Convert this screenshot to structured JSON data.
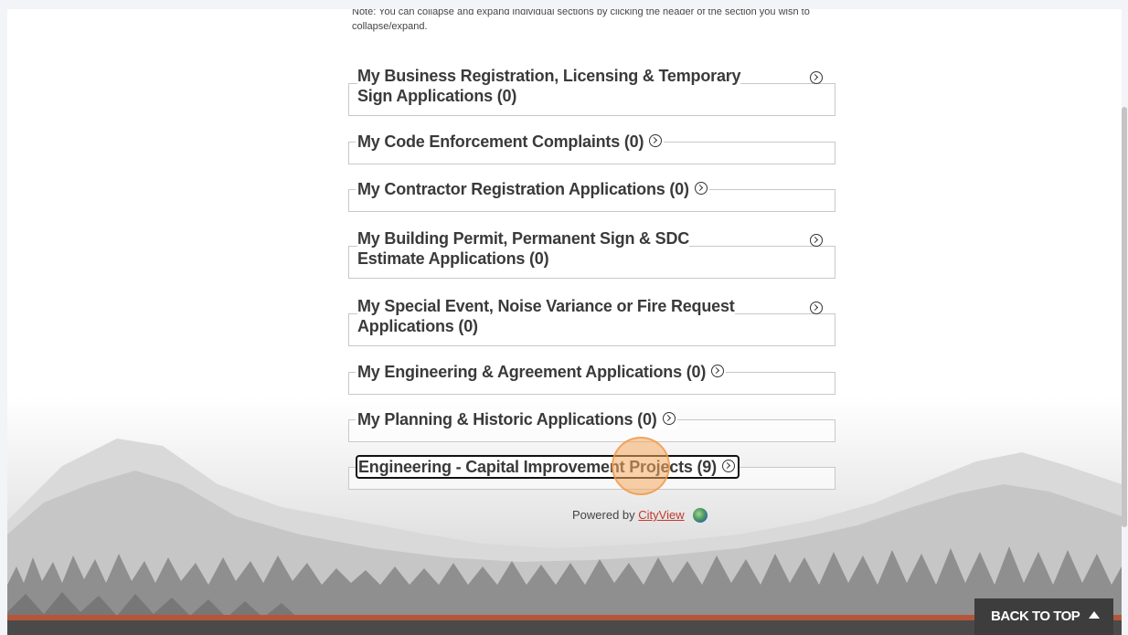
{
  "note": "Note: You can collapse and expand individual sections by clicking the header of the section you wish to collapse/expand.",
  "sections": [
    {
      "title": "My Business Registration, Licensing & Temporary Sign Applications (0)"
    },
    {
      "title": "My Code Enforcement Complaints (0)"
    },
    {
      "title": "My Contractor Registration Applications (0)"
    },
    {
      "title": "My Building Permit, Permanent Sign & SDC Estimate Applications (0)"
    },
    {
      "title": "My Special Event, Noise Variance or Fire Request Applications (0)"
    },
    {
      "title": "My Engineering & Agreement Applications (0)"
    },
    {
      "title": "My Planning & Historic Applications (0)"
    },
    {
      "title": "Engineering - Capital Improvement Projects (9)"
    }
  ],
  "footer": {
    "powered_by": "Powered by",
    "brand": "CityView",
    "back_to_top": "BACK TO TOP"
  },
  "colors": {
    "accent_bar": "#b5563a",
    "footer": "#4a4a4a",
    "link": "#c0392b",
    "click_highlight": "#f6aa60"
  }
}
